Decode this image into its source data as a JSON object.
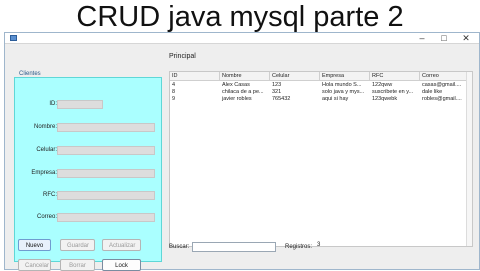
{
  "video_title": "CRUD java mysql parte 2",
  "window": {
    "minimize": "–",
    "maximize": "□",
    "close": "✕"
  },
  "panel": {
    "legend": "Clientes",
    "fields": [
      {
        "label": "ID:",
        "value": ""
      },
      {
        "label": "Nombre:",
        "value": ""
      },
      {
        "label": "Celular:",
        "value": ""
      },
      {
        "label": "Empresa:",
        "value": ""
      },
      {
        "label": "RFC:",
        "value": ""
      },
      {
        "label": "Correo:",
        "value": ""
      }
    ]
  },
  "buttons": {
    "nuevo": "Nuevo",
    "guardar": "Guardar",
    "actualizar": "Actualizar",
    "cancelar": "Cancelar",
    "borrar": "Borrar",
    "lock": "Lock"
  },
  "main": {
    "title": "Principal",
    "columns": [
      "ID",
      "Nombre",
      "Celular",
      "Empresa",
      "RFC",
      "Correo"
    ],
    "rows": [
      [
        "4",
        "Alex Casas",
        "123",
        "Hola mundo S...",
        "122qww",
        "casas@gmail...."
      ],
      [
        "8",
        "chilaca de a pe...",
        "321",
        "solo java y mys...",
        "suscribete en y...",
        "dale like"
      ],
      [
        "9",
        "javier robles",
        "765432",
        "aqui si hay",
        "123qwebk",
        "robles@gmail...."
      ]
    ]
  },
  "search": {
    "label": "Buscar:",
    "value": ""
  },
  "registros": {
    "label": "Registros:",
    "count": "3"
  },
  "colors": {
    "panel_bg": "#aaffff",
    "window_bg": "#eeeeee"
  }
}
